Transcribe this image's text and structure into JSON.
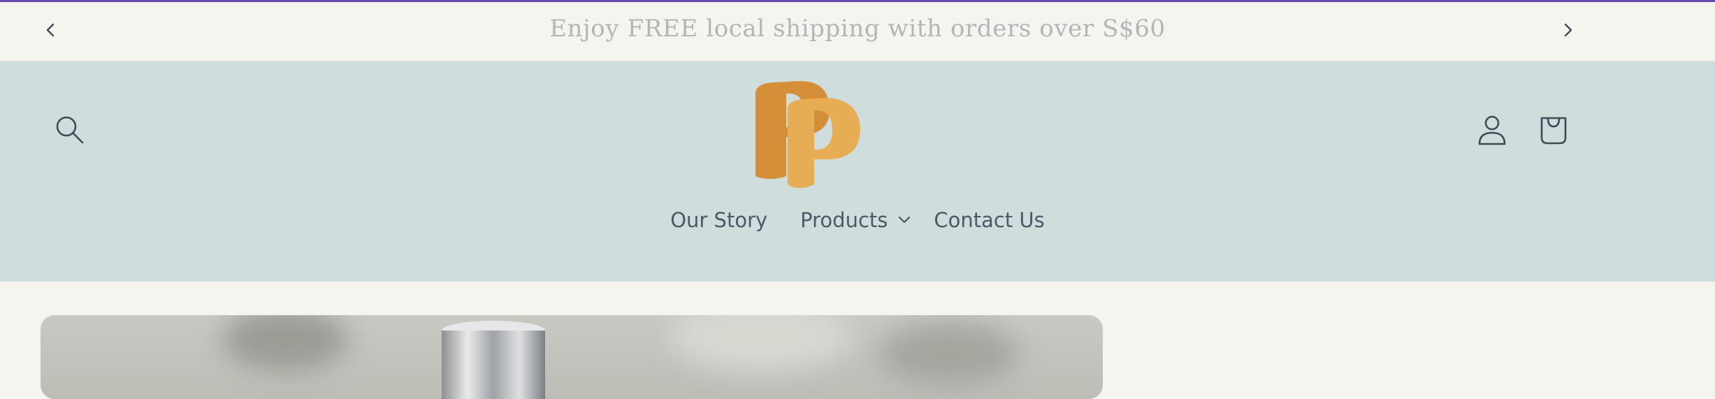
{
  "announcement": {
    "text": "Enjoy FREE local shipping with orders over S$60",
    "prev_icon": "chevron-left-icon",
    "next_icon": "chevron-right-icon"
  },
  "header": {
    "logo_alt": "PP",
    "icons": {
      "search": "search-icon",
      "account": "user-icon",
      "cart": "shopping-bag-icon"
    }
  },
  "nav": {
    "items": [
      {
        "label": "Our Story"
      },
      {
        "label": "Products",
        "has_dropdown": true
      },
      {
        "label": "Contact Us"
      }
    ]
  },
  "colors": {
    "accent_bar": "#6a4bb3",
    "header_bg": "#d0dddd",
    "page_bg": "#f6f4ef",
    "logo_dark": "#d48f38",
    "logo_light": "#e6ad55",
    "nav_text": "#4b5a66"
  }
}
